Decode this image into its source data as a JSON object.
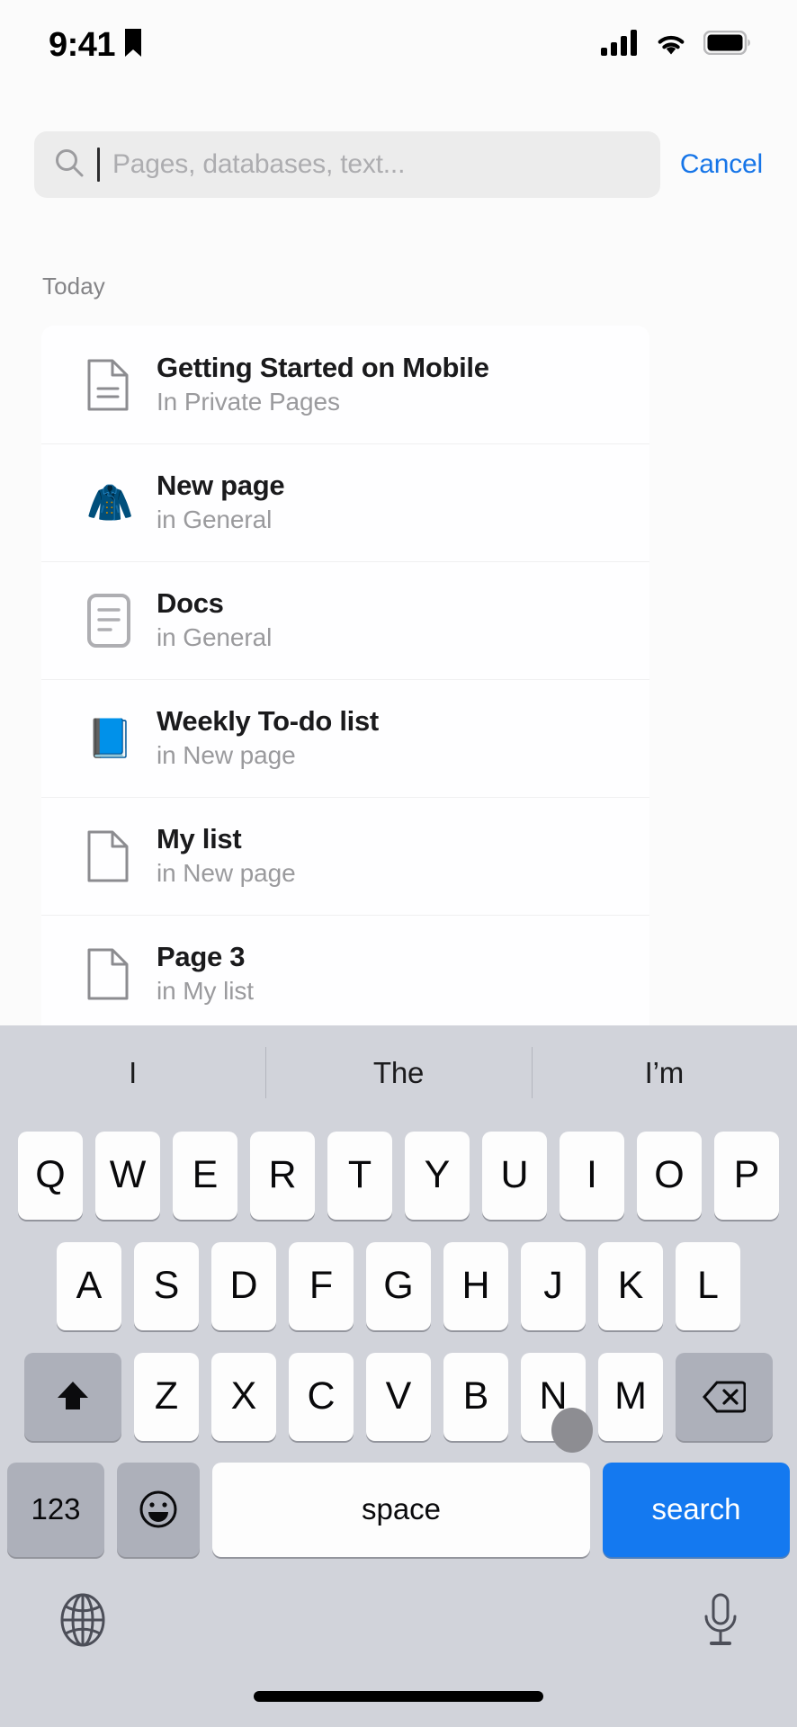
{
  "status_bar": {
    "time": "9:41",
    "bookmark_icon": "bookmark-icon",
    "cellular_icon": "cellular-signal-icon",
    "wifi_icon": "wifi-icon",
    "battery_icon": "battery-full-icon"
  },
  "search": {
    "placeholder": "Pages, databases, text...",
    "value": "",
    "icon": "search-icon",
    "cancel_label": "Cancel"
  },
  "results": {
    "section_label": "Today",
    "items": [
      {
        "title": "Getting Started on Mobile",
        "subtitle": "In Private Pages",
        "icon": "document-lines-icon",
        "icon_type": "svg-doc-lines"
      },
      {
        "title": "New page",
        "subtitle": "in General",
        "icon": "clothes-hanger-emoji",
        "icon_type": "emoji",
        "glyph": "🧥"
      },
      {
        "title": "Docs",
        "subtitle": "in General",
        "icon": "note-lines-icon",
        "icon_type": "svg-note-lines"
      },
      {
        "title": "Weekly To-do list",
        "subtitle": "in New page",
        "icon": "blue-book-emoji",
        "icon_type": "emoji",
        "glyph": "📘"
      },
      {
        "title": "My list",
        "subtitle": "in New page",
        "icon": "document-blank-icon",
        "icon_type": "svg-doc-blank"
      },
      {
        "title": "Page 3",
        "subtitle": "in My list",
        "icon": "document-blank-icon",
        "icon_type": "svg-doc-blank"
      }
    ]
  },
  "keyboard": {
    "predictions": [
      "I",
      "The",
      "I’m"
    ],
    "row1": [
      "Q",
      "W",
      "E",
      "R",
      "T",
      "Y",
      "U",
      "I",
      "O",
      "P"
    ],
    "row2": [
      "A",
      "S",
      "D",
      "F",
      "G",
      "H",
      "J",
      "K",
      "L"
    ],
    "row3": [
      "Z",
      "X",
      "C",
      "V",
      "B",
      "N",
      "M"
    ],
    "shift_icon": "shift-up-arrow-icon",
    "backspace_icon": "backspace-delete-icon",
    "numbers_label": "123",
    "emoji_icon": "emoji-smiley-icon",
    "space_label": "space",
    "search_label": "search",
    "globe_icon": "globe-language-icon",
    "mic_icon": "microphone-icon",
    "home_indicator": "home-indicator"
  },
  "colors": {
    "accent_blue": "#1479f0",
    "cancel_blue": "#1675e8",
    "keyboard_bg": "#d1d3da",
    "key_bg": "#fdfdfd",
    "special_key_bg": "#adb0ba",
    "card_bg": "#fefeff",
    "page_bg": "#fbfbfb"
  }
}
